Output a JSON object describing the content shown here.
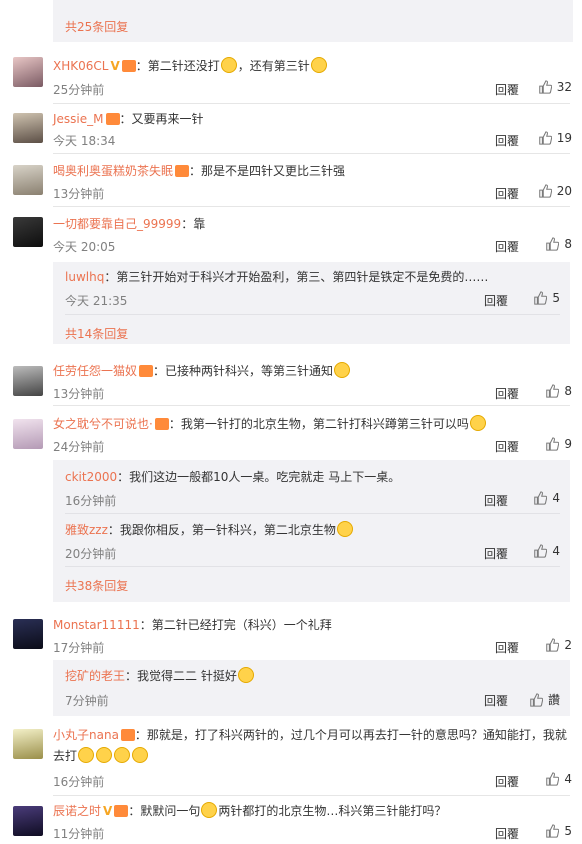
{
  "top_more": "共25条回复",
  "reply_label": "回覆",
  "comments": [
    {
      "user": "XHK06CL",
      "text": "：第二针还没打",
      "text2": "，还有第三针",
      "time": "25分钟前",
      "likes": "32"
    },
    {
      "user": "Jessie_M",
      "text": "：又要再来一针",
      "time": "今天 18:34",
      "likes": "19"
    },
    {
      "user": "喝奥利奥蛋糕奶茶失眠",
      "text": "：那是不是四针又更比三针强",
      "time": "13分钟前",
      "likes": "20"
    },
    {
      "user": "一切都要靠自己_99999",
      "text": "：靠",
      "time": "今天 20:05",
      "likes": "8",
      "replies": [
        {
          "user": "luwlhq",
          "text": "：第三针开始对于科兴才开始盈利，第三、第四针是铁定不是免费的……",
          "time": "今天 21:35",
          "likes": "5"
        }
      ],
      "more": "共14条回复"
    },
    {
      "user": "任劳任怨一猫奴",
      "text": "：已接种两针科兴，等第三针通知",
      "time": "13分钟前",
      "likes": "8"
    },
    {
      "user": "女之耽兮不可说也·",
      "text": "：我第一针打的北京生物，第二针打科兴蹲第三针可以吗",
      "time": "24分钟前",
      "likes": "9",
      "replies": [
        {
          "user": "ckit2000",
          "text": "：我们这边一般都10人一桌。吃完就走 马上下一桌。",
          "time": "16分钟前",
          "likes": "4"
        },
        {
          "user": "雅致zzz",
          "text": "：我跟你相反，第一针科兴，第二北京生物",
          "time": "20分钟前",
          "likes": "4"
        }
      ],
      "more": "共38条回复"
    },
    {
      "user": "Monstar11111",
      "text": "：第二针已经打完（科兴）一个礼拜",
      "time": "17分钟前",
      "likes": "2",
      "replies": [
        {
          "user": "挖矿的老王",
          "text": "：我觉得二二 针挺好",
          "time": "7分钟前",
          "likes": "讚"
        }
      ]
    },
    {
      "user": "小丸子nana",
      "text": "：那就是，打了科兴两针的，过几个月可以再去打一针的意思吗？通知能打，我就去打",
      "time": "16分钟前",
      "likes": "4"
    },
    {
      "user": "辰诺之时",
      "text": "：默默问一句",
      "text2": "两针都打的北京生物…科兴第三针能打吗？",
      "time": "11分钟前",
      "likes": "5"
    }
  ],
  "colors": {
    "accent": "#eb7350",
    "subbox": "#f2f2f5",
    "time": "#808080"
  }
}
